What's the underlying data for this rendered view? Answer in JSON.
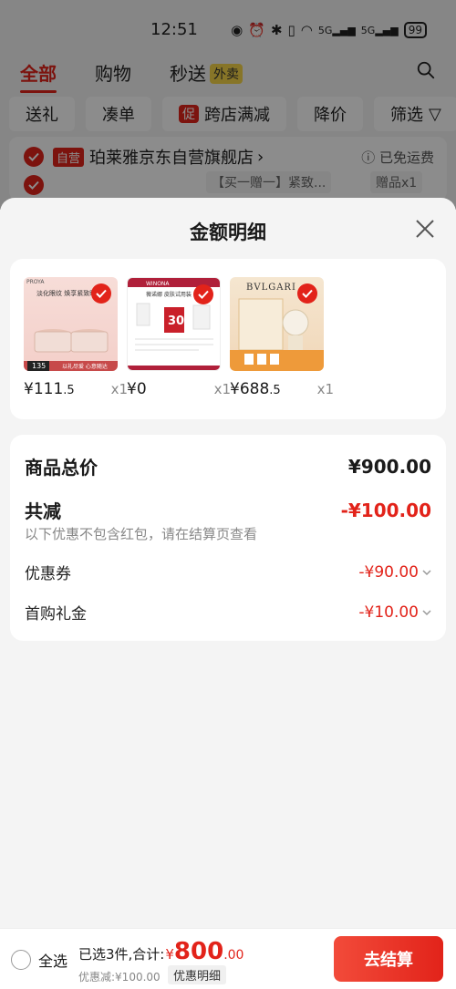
{
  "status_bar": {
    "time": "12:51",
    "battery": "99",
    "network": "5G"
  },
  "tabs": [
    {
      "label": "全部",
      "active": true
    },
    {
      "label": "购物",
      "active": false
    },
    {
      "label": "秒送",
      "active": false,
      "badge": "外卖"
    }
  ],
  "filters": [
    "送礼",
    "凑单",
    "跨店满减",
    "降价",
    "筛选"
  ],
  "filter_promo_tag": "促",
  "store": {
    "self_tag": "自营",
    "name": "珀莱雅京东自营旗舰店",
    "chevron": "›",
    "free_shipping": "已免运费",
    "item_preview": "【买一赠一】紧致...",
    "gift_tag": "赠品x1"
  },
  "sheet": {
    "title": "金额明细",
    "products": [
      {
        "price_main": "¥111",
        "price_dec": ".5",
        "qty": "x1",
        "thumb_brand": "PROYA",
        "thumb_text": "淡化眼纹 焕享紧致眼",
        "thumb_badge": "135",
        "thumb_footer": "以礼尽爱 心意随达"
      },
      {
        "price_main": "¥0",
        "price_dec": "",
        "qty": "x1",
        "thumb_brand": "WINONA",
        "thumb_text": "薇诺娜 皮肤试用装",
        "thumb_badge": "30"
      },
      {
        "price_main": "¥688",
        "price_dec": ".5",
        "qty": "x1",
        "thumb_brand": "BVLGARI"
      }
    ],
    "summary": {
      "total_label": "商品总价",
      "total_value": "¥900.00",
      "discount_label": "共减",
      "discount_value": "-¥100.00",
      "note": "以下优惠不包含红包，请在结算页查看",
      "coupon_label": "优惠券",
      "coupon_value": "-¥90.00",
      "gift_label": "首购礼金",
      "gift_value": "-¥10.00"
    }
  },
  "bottom": {
    "select_all": "全选",
    "selected_text": "已选3件,合计:",
    "currency": "¥",
    "amount_int": "800",
    "amount_dec": ".00",
    "reduced": "优惠减:¥100.00",
    "detail_button": "优惠明细",
    "checkout": "去结算"
  },
  "colors": {
    "accent": "#e2231a"
  }
}
